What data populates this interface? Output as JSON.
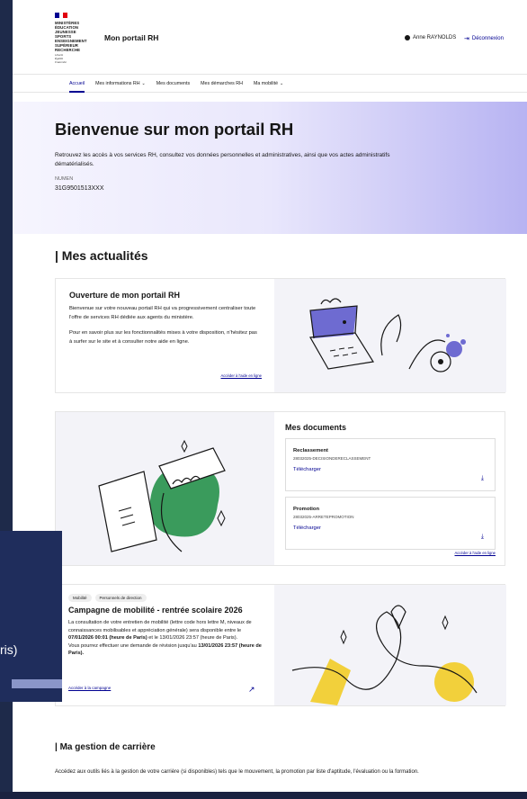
{
  "header": {
    "logo_lines": [
      "MINISTÈRES",
      "ÉDUCATION",
      "JEUNESSE",
      "SPORTS",
      "ENSEIGNEMENT",
      "SUPÉRIEUR",
      "RECHERCHE"
    ],
    "logo_motto": [
      "Liberté",
      "Égalité",
      "Fraternité"
    ],
    "site_title": "Mon portail RH",
    "user_name": "Anne RAYNOLDS",
    "logout_label": "Déconnexion"
  },
  "nav": {
    "items": [
      {
        "label": "Accueil"
      },
      {
        "label": "Mes informations RH"
      },
      {
        "label": "Mes documents"
      },
      {
        "label": "Mes démarches RH"
      },
      {
        "label": "Ma mobilité"
      }
    ]
  },
  "hero": {
    "title": "Bienvenue sur mon portail RH",
    "description": "Retrouvez les accès à vos services RH, consultez vos données personnelles et administratives, ainsi que vos actes administratifs dématérialisés.",
    "numen_label": "NUMEN",
    "numen_value": "31G9501513XXX"
  },
  "news": {
    "section_title": "| Mes actualités",
    "card_title": "Ouverture de mon portail RH",
    "paragraph1": "Bienvenue sur votre nouveau portail RH qui va progressivement centraliser toute l'offre de services RH dédiée aux agents du ministère.",
    "paragraph2": "Pour en savoir plus sur les fonctionnalités mises à votre disposition, n'hésitez pas à surfer sur le site et à consulter notre aide en ligne.",
    "link": "Accéder à l'aide en ligne"
  },
  "documents": {
    "title": "Mes documents",
    "items": [
      {
        "name": "Reclassement",
        "code": "28032025-DECISIONDERECLASSEMENT",
        "action": "Télécharger"
      },
      {
        "name": "Promotion",
        "code": "28032025-ARRETEPROMOTION",
        "action": "Télécharger"
      }
    ],
    "link": "Accéder à l'aide en ligne"
  },
  "mobility": {
    "tags": [
      "Mobilité",
      "Personnels de direction"
    ],
    "title": "Campagne de mobilité - rentrée scolaire 2026",
    "text_a": "La consultation de votre entretien de mobilité (lettre code hors lettre M, niveaux de connaissances mobilisables et appréciation générale) sera disponible entre le ",
    "date1": "07/01/2026 00:01 (heure de Paris)",
    "text_b": " et le 13/01/2026 23:57 (heure de Paris).",
    "text_c": "Vous pourrez effectuer une demande de révision jusqu'au ",
    "date2": "13/01/2026 23:57 (heure de Paris).",
    "link": "Accéder à la campagne"
  },
  "career": {
    "section_title": "| Ma gestion de carrière",
    "text": "Accédez aux outils liés à la gestion de votre carrière (si disponibles) tels que le mouvement, la promotion par liste d'aptitude, l'évaluation ou la formation."
  },
  "overlay": {
    "text": "ris)"
  },
  "colors": {
    "brand_blue": "#000091",
    "flag_red": "#e1000f",
    "illustration_purple": "#6e6bd1",
    "illustration_green": "#3a9b5c",
    "illustration_yellow": "#f2d03b",
    "overlay_navy": "#1f2d5c"
  }
}
